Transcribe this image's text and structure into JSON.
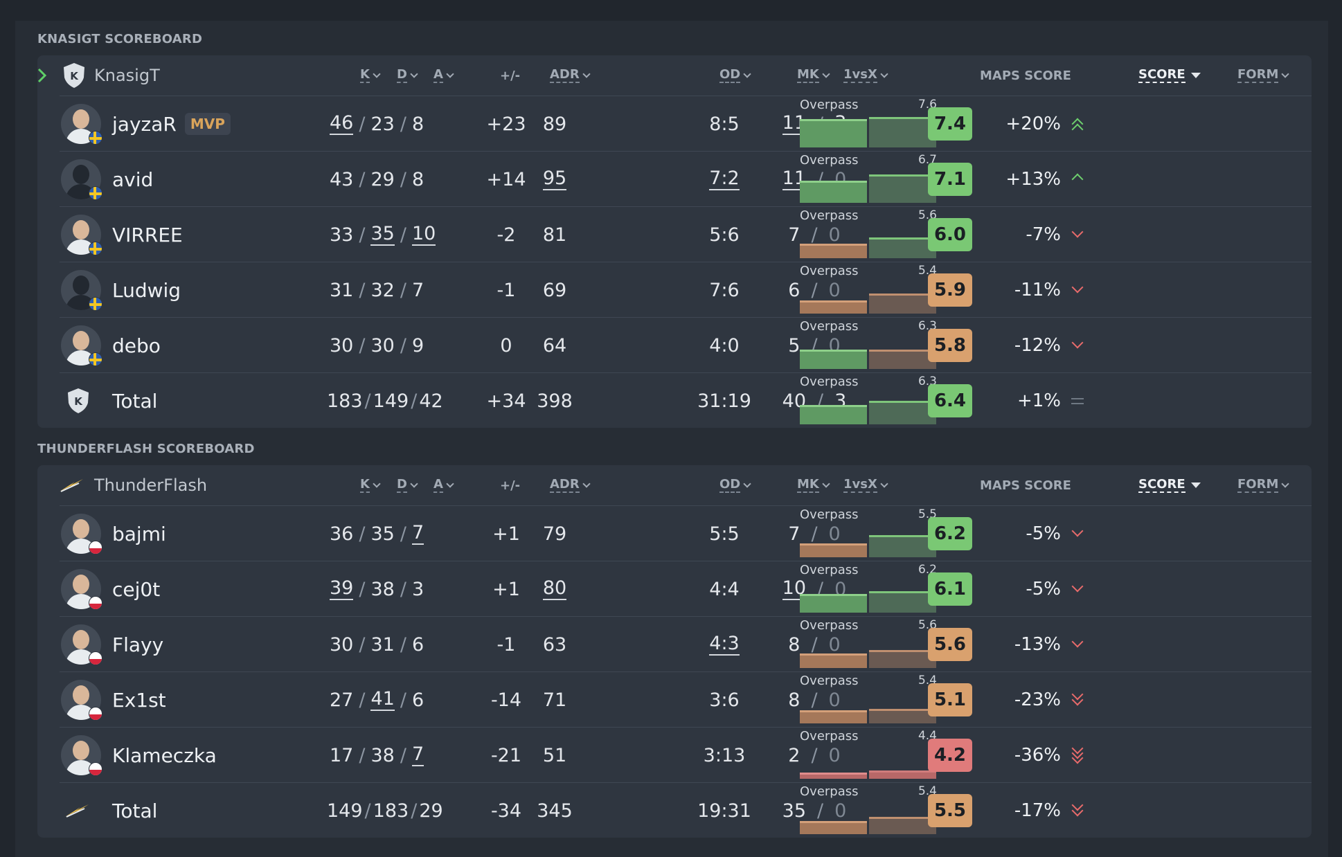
{
  "colors": {
    "green": "#7ac874",
    "orange": "#d9a16e",
    "red": "#e07b7b",
    "barGreen": "#5f9a63",
    "barGreenDark": "#4e6a57",
    "barOrange": "#a5785a",
    "barOrangeDark": "#6a5a52",
    "barRed": "#b86868"
  },
  "headers": {
    "k": "K",
    "d": "D",
    "a": "A",
    "pm": "+/-",
    "adr": "ADR",
    "od": "OD",
    "mk": "MK",
    "clutch": "1vsX",
    "maps": "MAPS SCORE",
    "score": "SCORE",
    "form": "FORM"
  },
  "teams": [
    {
      "section_title": "KNASIGT SCOREBOARD",
      "name": "KnasigT",
      "logo": "knasigt-shield-icon",
      "players": [
        {
          "name": "jayzaR",
          "mvp": "MVP",
          "flag": "se",
          "sil": false,
          "k": "46",
          "d": "23",
          "a": "8",
          "pm": "+23",
          "adr": "89",
          "od": "8:5",
          "mk": "11",
          "clutch": "3",
          "map": "Overpass",
          "mapval": "7.6",
          "score": "7.4",
          "form": "+20%",
          "trend": "up2"
        },
        {
          "name": "avid",
          "mvp": "",
          "flag": "se",
          "sil": true,
          "k": "43",
          "d": "29",
          "a": "8",
          "pm": "+14",
          "adr": "95",
          "od": "7:2",
          "mk": "11",
          "clutch": "0",
          "map": "Overpass",
          "mapval": "6.7",
          "score": "7.1",
          "form": "+13%",
          "trend": "up"
        },
        {
          "name": "VIRREE",
          "mvp": "",
          "flag": "se",
          "sil": false,
          "k": "33",
          "d": "35",
          "a": "10",
          "pm": "-2",
          "adr": "81",
          "od": "5:6",
          "mk": "7",
          "clutch": "0",
          "map": "Overpass",
          "mapval": "5.6",
          "score": "6.0",
          "form": "-7%",
          "trend": "down"
        },
        {
          "name": "Ludwig",
          "mvp": "",
          "flag": "se",
          "sil": true,
          "k": "31",
          "d": "32",
          "a": "7",
          "pm": "-1",
          "adr": "69",
          "od": "7:6",
          "mk": "6",
          "clutch": "0",
          "map": "Overpass",
          "mapval": "5.4",
          "score": "5.9",
          "form": "-11%",
          "trend": "down"
        },
        {
          "name": "debo",
          "mvp": "",
          "flag": "se",
          "sil": false,
          "k": "30",
          "d": "30",
          "a": "9",
          "pm": "0",
          "adr": "64",
          "od": "4:0",
          "mk": "5",
          "clutch": "0",
          "map": "Overpass",
          "mapval": "6.3",
          "score": "5.8",
          "form": "-12%",
          "trend": "down"
        }
      ],
      "total": {
        "name": "Total",
        "k": "183",
        "d": "149",
        "a": "42",
        "pm": "+34",
        "adr": "398",
        "od": "31:19",
        "mk": "40",
        "clutch": "3",
        "map": "Overpass",
        "mapval": "6.3",
        "score": "6.4",
        "form": "+1%",
        "trend": "eq"
      }
    },
    {
      "section_title": "THUNDERFLASH SCOREBOARD",
      "name": "ThunderFlash",
      "logo": "thunderflash-bolt-icon",
      "players": [
        {
          "name": "bajmi",
          "mvp": "",
          "flag": "pl",
          "sil": false,
          "k": "36",
          "d": "35",
          "a": "7",
          "pm": "+1",
          "adr": "79",
          "od": "5:5",
          "mk": "7",
          "clutch": "0",
          "map": "Overpass",
          "mapval": "5.5",
          "score": "6.2",
          "form": "-5%",
          "trend": "down"
        },
        {
          "name": "cej0t",
          "mvp": "",
          "flag": "pl",
          "sil": false,
          "k": "39",
          "d": "38",
          "a": "3",
          "pm": "+1",
          "adr": "80",
          "od": "4:4",
          "mk": "10",
          "clutch": "0",
          "map": "Overpass",
          "mapval": "6.2",
          "score": "6.1",
          "form": "-5%",
          "trend": "down"
        },
        {
          "name": "Flayy",
          "mvp": "",
          "flag": "pl",
          "sil": false,
          "k": "30",
          "d": "31",
          "a": "6",
          "pm": "-1",
          "adr": "63",
          "od": "4:3",
          "mk": "8",
          "clutch": "0",
          "map": "Overpass",
          "mapval": "5.6",
          "score": "5.6",
          "form": "-13%",
          "trend": "down"
        },
        {
          "name": "Ex1st",
          "mvp": "",
          "flag": "pl",
          "sil": false,
          "k": "27",
          "d": "41",
          "a": "6",
          "pm": "-14",
          "adr": "71",
          "od": "3:6",
          "mk": "8",
          "clutch": "0",
          "map": "Overpass",
          "mapval": "5.4",
          "score": "5.1",
          "form": "-23%",
          "trend": "down2"
        },
        {
          "name": "Klameczka",
          "mvp": "",
          "flag": "pl",
          "sil": false,
          "k": "17",
          "d": "38",
          "a": "7",
          "pm": "-21",
          "adr": "51",
          "od": "3:13",
          "mk": "2",
          "clutch": "0",
          "map": "Overpass",
          "mapval": "4.4",
          "score": "4.2",
          "form": "-36%",
          "trend": "down3"
        }
      ],
      "total": {
        "name": "Total",
        "k": "149",
        "d": "183",
        "a": "29",
        "pm": "-34",
        "adr": "345",
        "od": "19:31",
        "mk": "35",
        "clutch": "0",
        "map": "Overpass",
        "mapval": "5.4",
        "score": "5.5",
        "form": "-17%",
        "trend": "down2"
      }
    }
  ]
}
